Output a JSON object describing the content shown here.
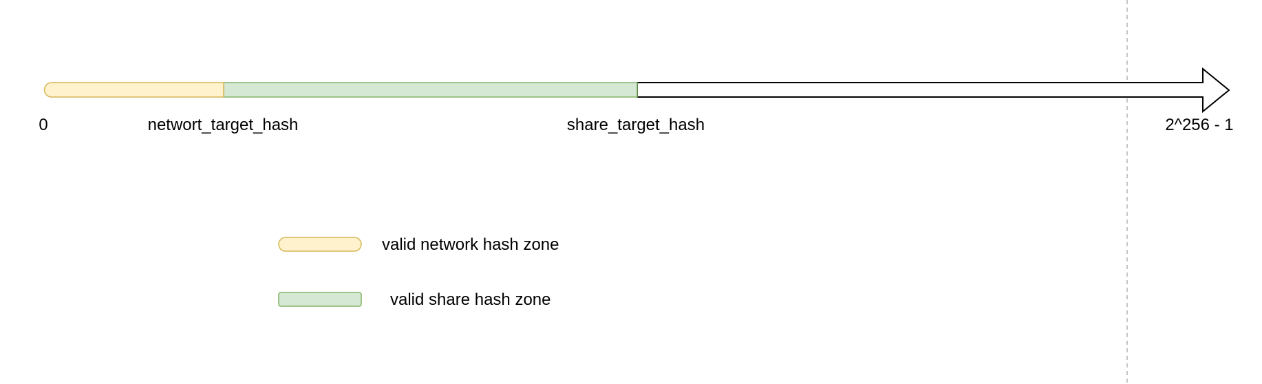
{
  "axis": {
    "start_label": "0",
    "end_label": "2^256 - 1"
  },
  "markers": {
    "network_target_label": "networt_target_hash",
    "share_target_label": "share_target_hash"
  },
  "legend": {
    "items": [
      {
        "label": "valid network hash zone",
        "fill": "#fff2cc",
        "stroke": "#d6b656"
      },
      {
        "label": "valid share hash zone",
        "fill": "#d5e8d4",
        "stroke": "#82b366"
      }
    ]
  },
  "colors": {
    "network_zone_fill": "#fff2cc",
    "network_zone_stroke": "#d6b656",
    "share_zone_fill": "#d5e8d4",
    "share_zone_stroke": "#82b366",
    "arrow_stroke": "#000000",
    "guide_line": "#b3b3b3"
  }
}
